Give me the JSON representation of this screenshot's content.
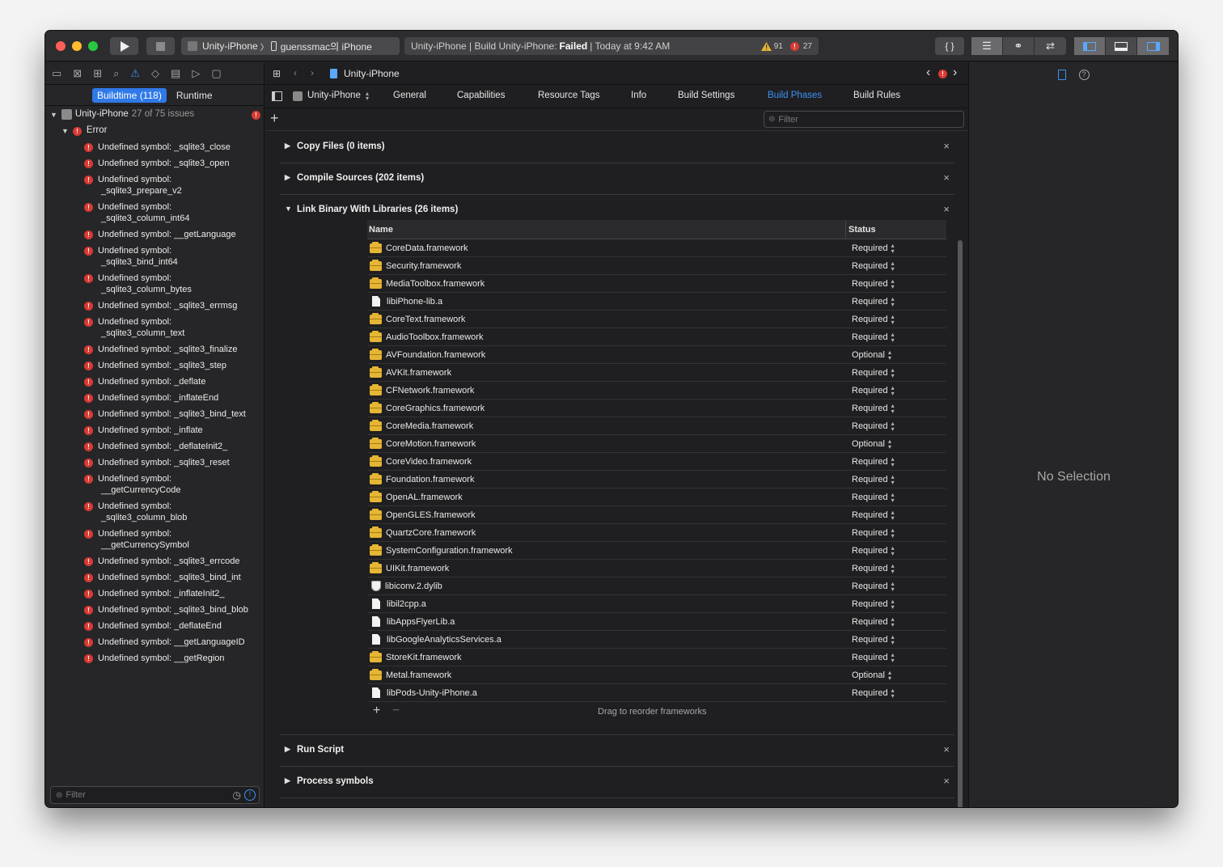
{
  "toolbar": {
    "scheme_target": "Unity-iPhone",
    "scheme_sep": "〉",
    "scheme_device": "guenssmac의 iPhone",
    "activity_prefix": "Unity-iPhone | Build Unity-iPhone:",
    "activity_status": "Failed",
    "activity_suffix": "| Today at 9:42 AM",
    "warning_count": "91",
    "error_count": "27"
  },
  "navigator": {
    "tabs": {
      "buildtime": "Buildtime (118)",
      "runtime": "Runtime"
    },
    "project": "Unity-iPhone",
    "project_summary": "27 of 75 issues",
    "group": "Error",
    "issues": [
      [
        "Undefined symbol: _sqlite3_close"
      ],
      [
        "Undefined symbol: _sqlite3_open"
      ],
      [
        "Undefined symbol:",
        "_sqlite3_prepare_v2"
      ],
      [
        "Undefined symbol:",
        "_sqlite3_column_int64"
      ],
      [
        "Undefined symbol: __getLanguage"
      ],
      [
        "Undefined symbol:",
        "_sqlite3_bind_int64"
      ],
      [
        "Undefined symbol:",
        "_sqlite3_column_bytes"
      ],
      [
        "Undefined symbol: _sqlite3_errmsg"
      ],
      [
        "Undefined symbol:",
        "_sqlite3_column_text"
      ],
      [
        "Undefined symbol: _sqlite3_finalize"
      ],
      [
        "Undefined symbol: _sqlite3_step"
      ],
      [
        "Undefined symbol: _deflate"
      ],
      [
        "Undefined symbol: _inflateEnd"
      ],
      [
        "Undefined symbol: _sqlite3_bind_text"
      ],
      [
        "Undefined symbol: _inflate"
      ],
      [
        "Undefined symbol: _deflateInit2_"
      ],
      [
        "Undefined symbol: _sqlite3_reset"
      ],
      [
        "Undefined symbol:",
        "__getCurrencyCode"
      ],
      [
        "Undefined symbol:",
        "_sqlite3_column_blob"
      ],
      [
        "Undefined symbol:",
        "__getCurrencySymbol"
      ],
      [
        "Undefined symbol: _sqlite3_errcode"
      ],
      [
        "Undefined symbol: _sqlite3_bind_int"
      ],
      [
        "Undefined symbol: _inflateInit2_"
      ],
      [
        "Undefined symbol: _sqlite3_bind_blob"
      ],
      [
        "Undefined symbol: _deflateEnd"
      ],
      [
        "Undefined symbol: __getLanguageID"
      ],
      [
        "Undefined symbol: __getRegion"
      ]
    ],
    "filter_placeholder": "Filter"
  },
  "editor": {
    "jump_file": "Unity-iPhone",
    "target": "Unity-iPhone",
    "tabs": {
      "general": "General",
      "capabilities": "Capabilities",
      "resource_tags": "Resource Tags",
      "info": "Info",
      "build_settings": "Build Settings",
      "build_phases": "Build Phases",
      "build_rules": "Build Rules"
    },
    "filter_placeholder": "Filter",
    "phases": {
      "copy_files": "Copy Files (0 items)",
      "compile_sources": "Compile Sources (202 items)",
      "link_binary": "Link Binary With Libraries (26 items)",
      "run_script": "Run Script",
      "process_symbols": "Process symbols"
    },
    "libraries": {
      "col_name": "Name",
      "col_status": "Status",
      "rows": [
        {
          "name": "CoreData.framework",
          "status": "Required",
          "icon": "framework"
        },
        {
          "name": "Security.framework",
          "status": "Required",
          "icon": "framework"
        },
        {
          "name": "MediaToolbox.framework",
          "status": "Required",
          "icon": "framework"
        },
        {
          "name": "libiPhone-lib.a",
          "status": "Required",
          "icon": "file"
        },
        {
          "name": "CoreText.framework",
          "status": "Required",
          "icon": "framework"
        },
        {
          "name": "AudioToolbox.framework",
          "status": "Required",
          "icon": "framework"
        },
        {
          "name": "AVFoundation.framework",
          "status": "Optional",
          "icon": "framework"
        },
        {
          "name": "AVKit.framework",
          "status": "Required",
          "icon": "framework"
        },
        {
          "name": "CFNetwork.framework",
          "status": "Required",
          "icon": "framework"
        },
        {
          "name": "CoreGraphics.framework",
          "status": "Required",
          "icon": "framework"
        },
        {
          "name": "CoreMedia.framework",
          "status": "Required",
          "icon": "framework"
        },
        {
          "name": "CoreMotion.framework",
          "status": "Optional",
          "icon": "framework"
        },
        {
          "name": "CoreVideo.framework",
          "status": "Required",
          "icon": "framework"
        },
        {
          "name": "Foundation.framework",
          "status": "Required",
          "icon": "framework"
        },
        {
          "name": "OpenAL.framework",
          "status": "Required",
          "icon": "framework"
        },
        {
          "name": "OpenGLES.framework",
          "status": "Required",
          "icon": "framework"
        },
        {
          "name": "QuartzCore.framework",
          "status": "Required",
          "icon": "framework"
        },
        {
          "name": "SystemConfiguration.framework",
          "status": "Required",
          "icon": "framework"
        },
        {
          "name": "UIKit.framework",
          "status": "Required",
          "icon": "framework"
        },
        {
          "name": "libiconv.2.dylib",
          "status": "Required",
          "icon": "dylib"
        },
        {
          "name": "libil2cpp.a",
          "status": "Required",
          "icon": "file"
        },
        {
          "name": "libAppsFlyerLib.a",
          "status": "Required",
          "icon": "file"
        },
        {
          "name": "libGoogleAnalyticsServices.a",
          "status": "Required",
          "icon": "file"
        },
        {
          "name": "StoreKit.framework",
          "status": "Required",
          "icon": "framework"
        },
        {
          "name": "Metal.framework",
          "status": "Optional",
          "icon": "framework"
        },
        {
          "name": "libPods-Unity-iPhone.a",
          "status": "Required",
          "icon": "file"
        }
      ],
      "drag_hint": "Drag to reorder frameworks"
    }
  },
  "inspector": {
    "empty_label": "No Selection"
  },
  "colors": {
    "accent": "#3b91f5",
    "error": "#d83a34",
    "warning": "#e5b534",
    "framework": "#e5b534"
  }
}
